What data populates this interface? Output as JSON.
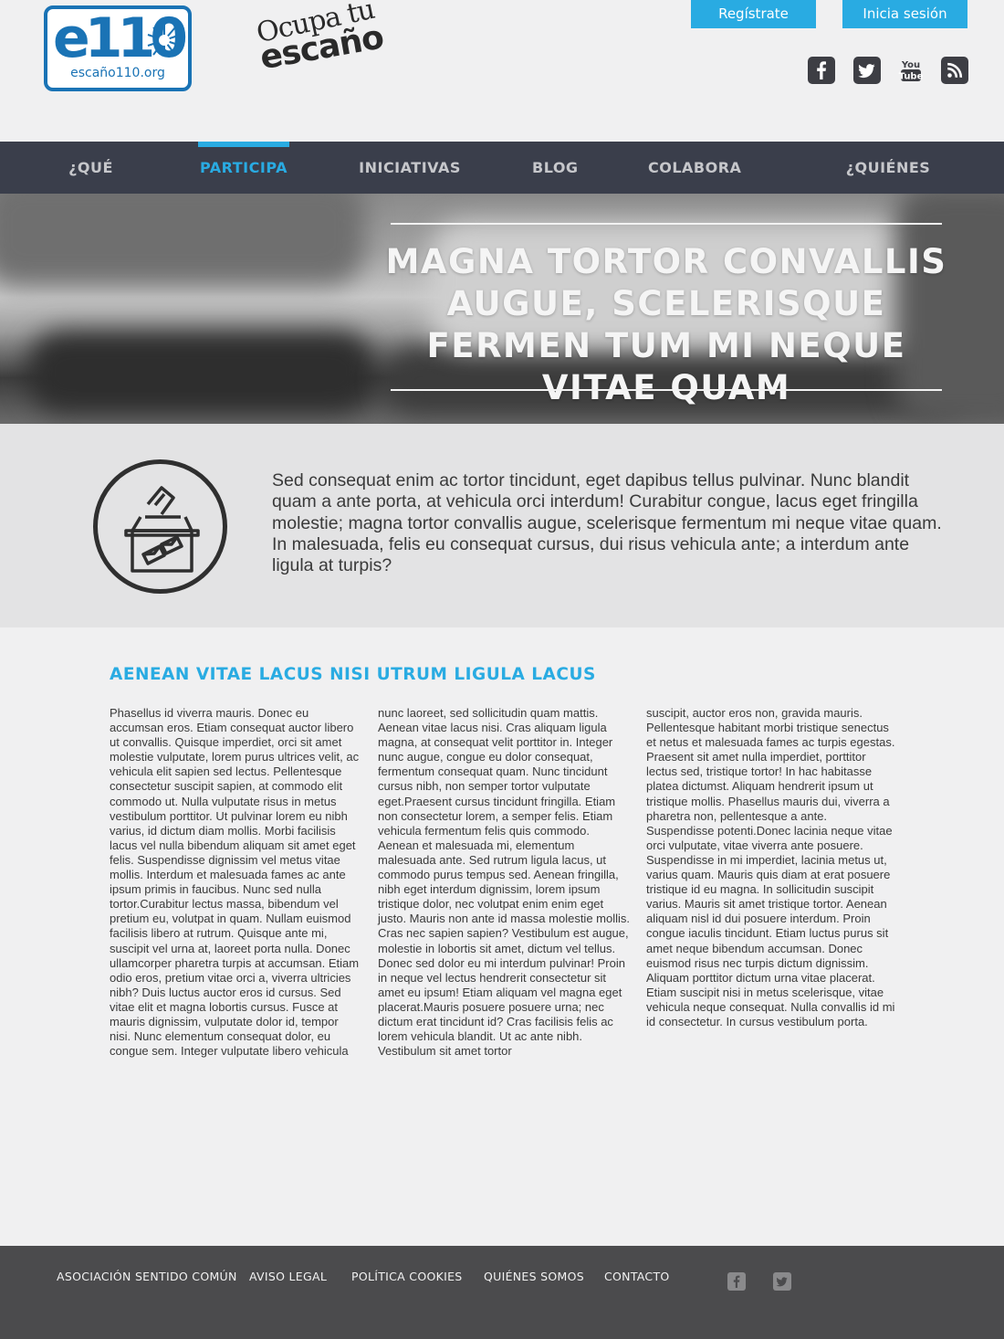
{
  "header": {
    "logo_main": "e110",
    "logo_sub": "escaño110.org",
    "logo_slogan_1": "Ocupa tu",
    "logo_slogan_2": "escaño",
    "register_label": "Regístrate",
    "login_label": "Inicia sesión",
    "social": [
      "facebook-icon",
      "twitter-icon",
      "youtube-icon",
      "rss-icon"
    ]
  },
  "nav": {
    "items": [
      {
        "label": "¿QUÉ ES?",
        "active": false
      },
      {
        "label": "PARTICIPA",
        "active": true
      },
      {
        "label": "INICIATIVAS",
        "active": false
      },
      {
        "label": "BLOG",
        "active": false
      },
      {
        "label": "COLABORA",
        "active": false
      },
      {
        "label": "¿QUIÉNES SOMOS?",
        "active": false
      }
    ]
  },
  "hero": {
    "title": "MAGNA TORTOR CONVALLIS AUGUE, SCELERISQUE FERMEN TUM MI NEQUE VITAE QUAM"
  },
  "intro": {
    "icon": "ballot-box-icon",
    "text": "Sed consequat enim ac tortor tincidunt, eget dapibus tellus pulvinar. Nunc blandit quam a ante porta, at vehicula orci interdum! Curabitur congue, lacus eget fringilla molestie; magna tortor convallis augue, scelerisque fermentum mi neque vitae quam. In malesuada, felis eu consequat cursus, dui risus vehicula ante; a interdum ante ligula at turpis?"
  },
  "article": {
    "title": "AENEAN VITAE LACUS NISI UTRUM LIGULA LACUS",
    "columns": [
      "Phasellus id viverra mauris. Donec eu accumsan eros. Etiam consequat auctor libero ut convallis. Quisque imperdiet, orci sit amet molestie vulputate, lorem purus ultrices velit, ac vehicula elit sapien sed lectus. Pellentesque consectetur suscipit sapien, at commodo elit commodo ut. Nulla vulputate risus in metus vestibulum porttitor. Ut pulvinar lorem eu nibh varius, id dictum diam mollis. Morbi facilisis lacus vel nulla bibendum aliquam sit amet eget felis. Suspendisse dignissim vel metus vitae mollis. Interdum et malesuada fames ac ante ipsum primis in faucibus. Nunc sed nulla tortor.Curabitur lectus massa, bibendum vel pretium eu, volutpat in quam. Nullam euismod facilisis libero at rutrum. Quisque ante mi, suscipit vel urna at, laoreet porta nulla. Donec ullamcorper pharetra turpis at accumsan. Etiam odio eros, pretium vitae orci a, viverra ultricies nibh? Duis luctus auctor eros id cursus. Sed vitae elit et magna lobortis cursus. Fusce at mauris dignissim, vulputate dolor id, tempor nisi. Nunc elementum consequat dolor, eu congue sem. Integer vulputate libero vehicula",
      "nunc laoreet, sed sollicitudin quam mattis. Aenean vitae lacus nisi. Cras aliquam ligula magna, at consequat velit porttitor in. Integer nunc augue, congue eu dolor consequat, fermentum consequat quam. Nunc tincidunt cursus nibh, non semper tortor vulputate eget.Praesent cursus tincidunt fringilla. Etiam non consectetur lorem, a semper felis. Etiam vehicula fermentum felis quis commodo. Aenean et malesuada mi, elementum malesuada ante. Sed rutrum ligula lacus, ut commodo purus tempus sed. Aenean fringilla, nibh eget interdum dignissim, lorem ipsum tristique dolor, nec volutpat enim enim eget justo. Mauris non ante id massa molestie mollis. Cras nec sapien sapien? Vestibulum est augue, molestie in lobortis sit amet, dictum vel tellus. Donec sed dolor eu mi interdum pulvinar! Proin in neque vel lectus hendrerit consectetur sit amet eu ipsum! Etiam aliquam vel magna eget placerat.Mauris posuere posuere urna; nec dictum erat tincidunt id? Cras facilisis felis ac lorem vehicula blandit. Ut ac ante nibh. Vestibulum sit amet tortor",
      "suscipit, auctor eros non, gravida mauris. Pellentesque habitant morbi tristique senectus et netus et malesuada fames ac turpis egestas. Praesent sit amet nulla imperdiet, porttitor lectus sed, tristique tortor! In hac habitasse platea dictumst. Aliquam hendrerit ipsum ut tristique mollis. Phasellus mauris dui, viverra a pharetra non, pellentesque a ante. Suspendisse potenti.Donec lacinia neque vitae orci vulputate, vitae viverra ante posuere. Suspendisse in mi imperdiet, lacinia metus ut, varius quam. Mauris quis diam at erat posuere tristique id eu magna. In sollicitudin suscipit varius. Mauris sit amet tristique tortor. Aenean aliquam nisl id dui posuere interdum. Proin congue iaculis tincidunt. Etiam luctus purus sit amet neque bibendum accumsan. Donec euismod risus nec turpis dictum dignissim. Aliquam porttitor dictum urna vitae placerat. Etiam suscipit nisi in metus scelerisque, vitae vehicula neque consequat. Nulla convallis id mi id consectetur. In cursus vestibulum porta."
    ]
  },
  "footer": {
    "links": [
      "ASOCIACIÓN SENTIDO COMÚN",
      "AVISO LEGAL",
      "POLÍTICA COOKIES",
      "QUIÉNES SOMOS",
      "CONTACTO"
    ],
    "social": [
      "facebook-icon",
      "twitter-icon"
    ]
  },
  "colors": {
    "accent": "#29abe2",
    "logo_blue": "#1a73b5",
    "nav_bg": "#3a3e4b",
    "intro_bg": "#e3e3e4",
    "page_bg": "#f0f0f1",
    "footer_bg": "#4b4b4d"
  }
}
